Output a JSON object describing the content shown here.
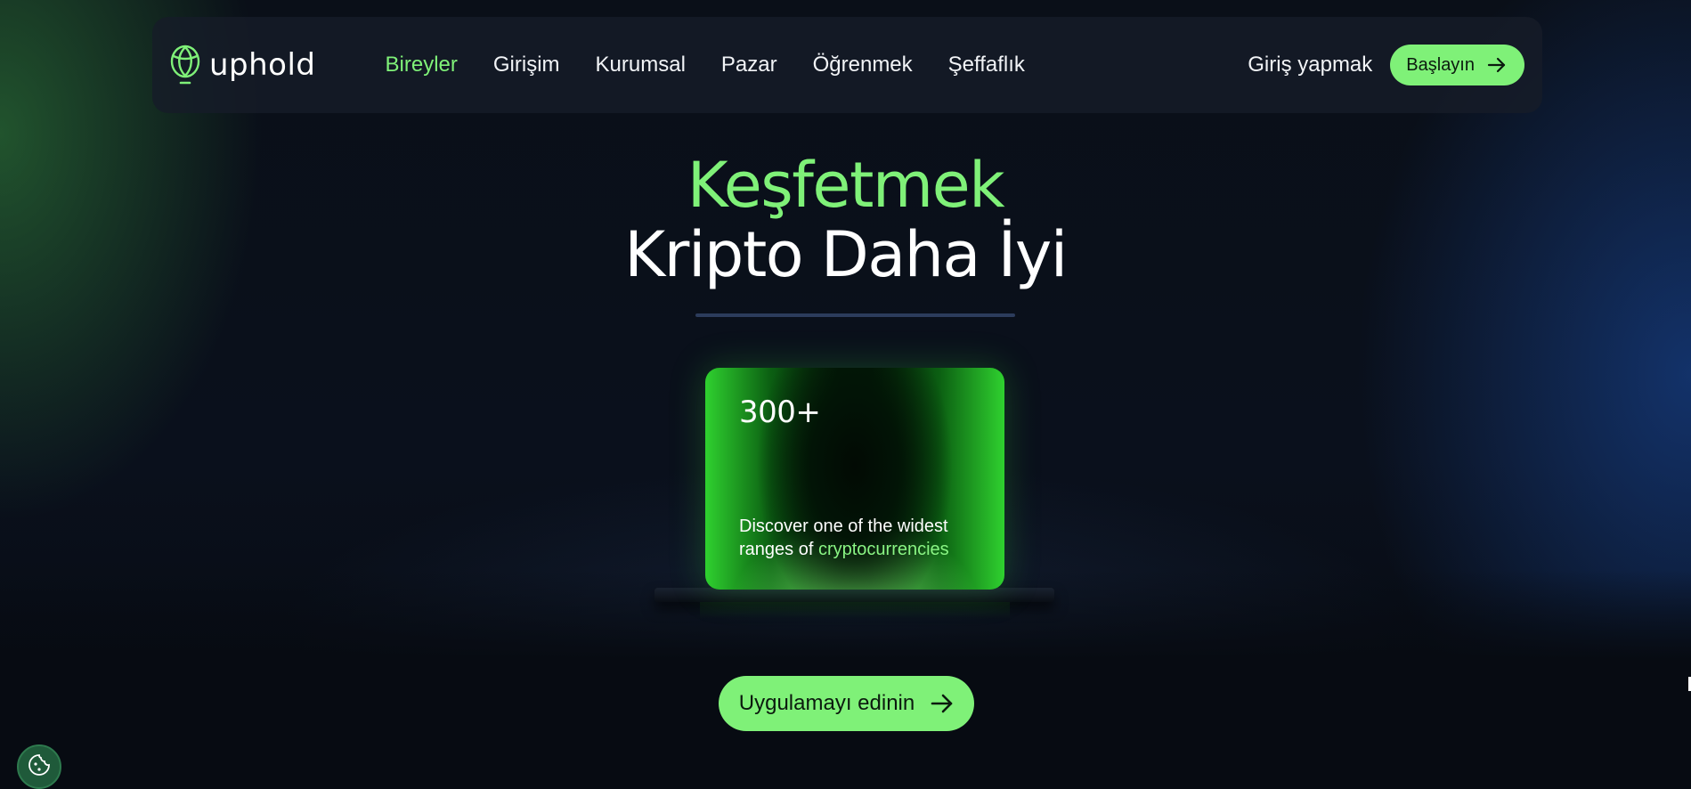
{
  "brand": {
    "name": "uphold"
  },
  "nav": {
    "items": [
      {
        "label": "Bireyler",
        "active": true
      },
      {
        "label": "Girişim",
        "active": false
      },
      {
        "label": "Kurumsal",
        "active": false
      },
      {
        "label": "Pazar",
        "active": false
      },
      {
        "label": "Öğrenmek",
        "active": false
      },
      {
        "label": "Şeffaflık",
        "active": false
      }
    ],
    "login_label": "Giriş yapmak",
    "start_label": "Başlayın"
  },
  "hero": {
    "line1": "Keşfetmek",
    "line2": "Kripto Daha İyi"
  },
  "stat_card": {
    "value": "300+",
    "desc_prefix": "Discover one of the widest ranges of ",
    "desc_accent": "cryptocurrencies"
  },
  "cta": {
    "label": "Uygulamayı edinin"
  },
  "icons": {
    "logo": "uphold-logo-icon",
    "arrow": "arrow-right-icon",
    "cookie": "cookie-icon"
  },
  "colors": {
    "accent": "#7ff178",
    "background": "#070b12",
    "navbar": "#161c28",
    "divider": "#2c3c5c",
    "cookie_bg": "#1f5a3a"
  }
}
